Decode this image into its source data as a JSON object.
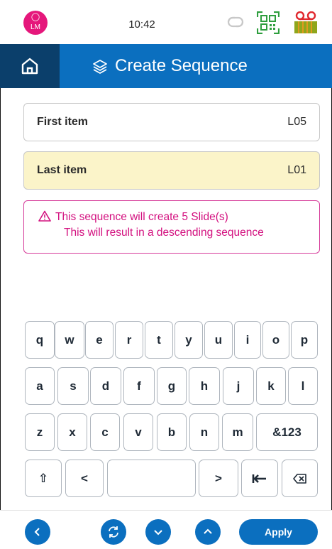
{
  "status_bar": {
    "avatar_initials": "LM",
    "time": "10:42",
    "icons": [
      "user-icon",
      "sync-icon",
      "qr-code-icon",
      "tape-icon"
    ]
  },
  "header": {
    "title": "Create Sequence",
    "icons": [
      "home-icon",
      "layers-icon"
    ]
  },
  "fields": {
    "first": {
      "label": "First item",
      "value": "L05"
    },
    "last": {
      "label": "Last item",
      "value": "L01"
    }
  },
  "notice": {
    "line1": "This sequence will create 5 Slide(s)",
    "line2": "This will result in a descending sequence"
  },
  "keyboard": {
    "row1": [
      "q",
      "w",
      "e",
      "r",
      "t",
      "y",
      "u",
      "i",
      "o",
      "p"
    ],
    "row2": [
      "a",
      "s",
      "d",
      "f",
      "g",
      "h",
      "j",
      "k",
      "l"
    ],
    "row3": [
      "z",
      "x",
      "c",
      "v",
      "b",
      "n",
      "m",
      "&123"
    ],
    "row4": [
      "⇧",
      "<",
      "",
      ">",
      "",
      ""
    ]
  },
  "footer": {
    "apply_label": "Apply",
    "icons": [
      "back-icon",
      "refresh-icon",
      "chevron-down-icon",
      "chevron-up-icon"
    ]
  },
  "colors": {
    "primary": "#0b6fbf",
    "header_dark": "#0b3f6b",
    "accent_pink": "#d3107f",
    "highlight_field": "#fbf4c9",
    "qr_green": "#2e9e3e"
  }
}
